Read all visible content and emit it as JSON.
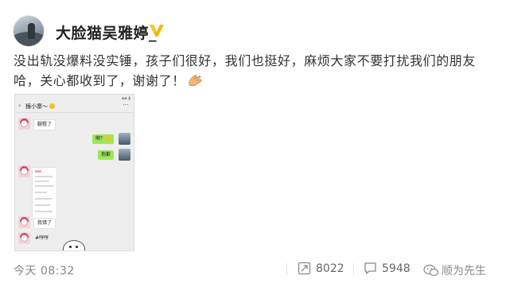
{
  "post": {
    "username": "大脸猫吴雅婷_",
    "content": "没出轨没爆料没实锤，孩子们很好，我们也挺好，麻烦大家不要打扰我们的朋友哈，关心都收到了，谢谢了！",
    "timestamp": "今天 08:32",
    "repost_count": "8022",
    "comment_count": "5948",
    "watermark": "顺为先生"
  },
  "screenshot": {
    "chat_title": "猴小寨～",
    "messages": [
      {
        "side": "in",
        "text": "腿粗了"
      },
      {
        "side": "out",
        "text": "啊？"
      },
      {
        "side": "out",
        "text": "抱歉"
      },
      {
        "side": "in",
        "text": "我错了"
      },
      {
        "side": "in",
        "text": "#哼哼"
      }
    ]
  },
  "colors": {
    "verified_badge": "#f5b800",
    "bubble_out": "#9fe658",
    "text": "#333333",
    "muted": "#888888"
  },
  "icons": {
    "verified": "v-badge-icon",
    "clap": "hands-emoji-icon",
    "repost": "repost-icon",
    "comment": "comment-icon",
    "watermark": "wechat-icon"
  }
}
